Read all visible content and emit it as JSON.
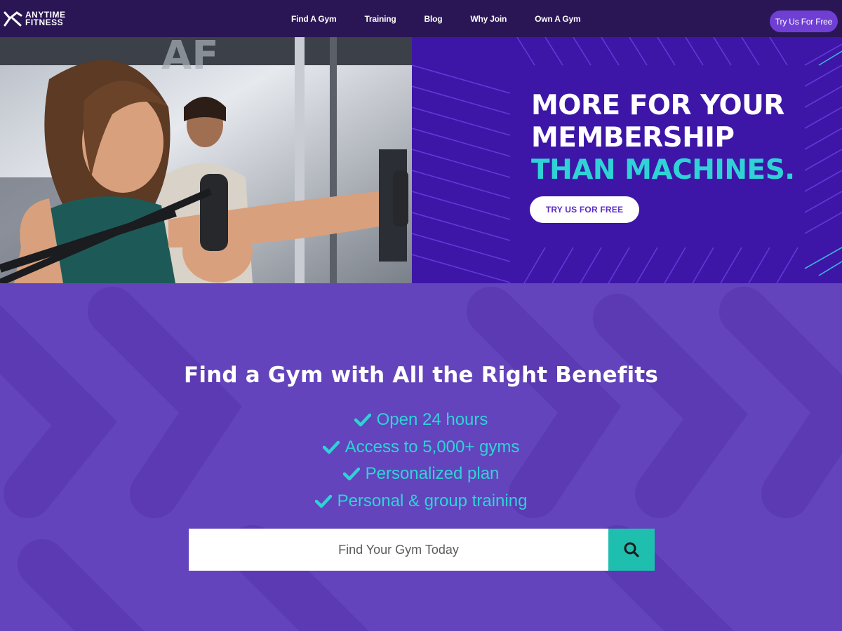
{
  "brand": {
    "logo_line1": "ANYTIME",
    "logo_line2": "FITNESS",
    "logo_icon": "running-figure-icon",
    "primary_color": "#2a1655",
    "accent_color": "#2fd3d6",
    "purple": "#6344bd"
  },
  "nav": {
    "links": [
      {
        "label": "Find A Gym"
      },
      {
        "label": "Training"
      },
      {
        "label": "Blog"
      },
      {
        "label": "Why Join"
      },
      {
        "label": "Own A Gym"
      }
    ],
    "cta_label": "Try Us For Free"
  },
  "hero": {
    "headline_line1": "MORE FOR YOUR",
    "headline_line2": "MEMBERSHIP",
    "headline_line3": "THAN MACHINES.",
    "button_label": "TRY US FOR FREE"
  },
  "benefits": {
    "title": "Find a Gym with All the Right Benefits",
    "items": [
      {
        "label": "Open 24 hours",
        "icon": "check-icon"
      },
      {
        "label": "Access to 5,000+ gyms",
        "icon": "check-icon"
      },
      {
        "label": "Personalized plan",
        "icon": "check-icon"
      },
      {
        "label": "Personal & group training",
        "icon": "check-icon"
      }
    ],
    "search_placeholder": "Find Your Gym Today",
    "search_icon": "search-icon"
  }
}
